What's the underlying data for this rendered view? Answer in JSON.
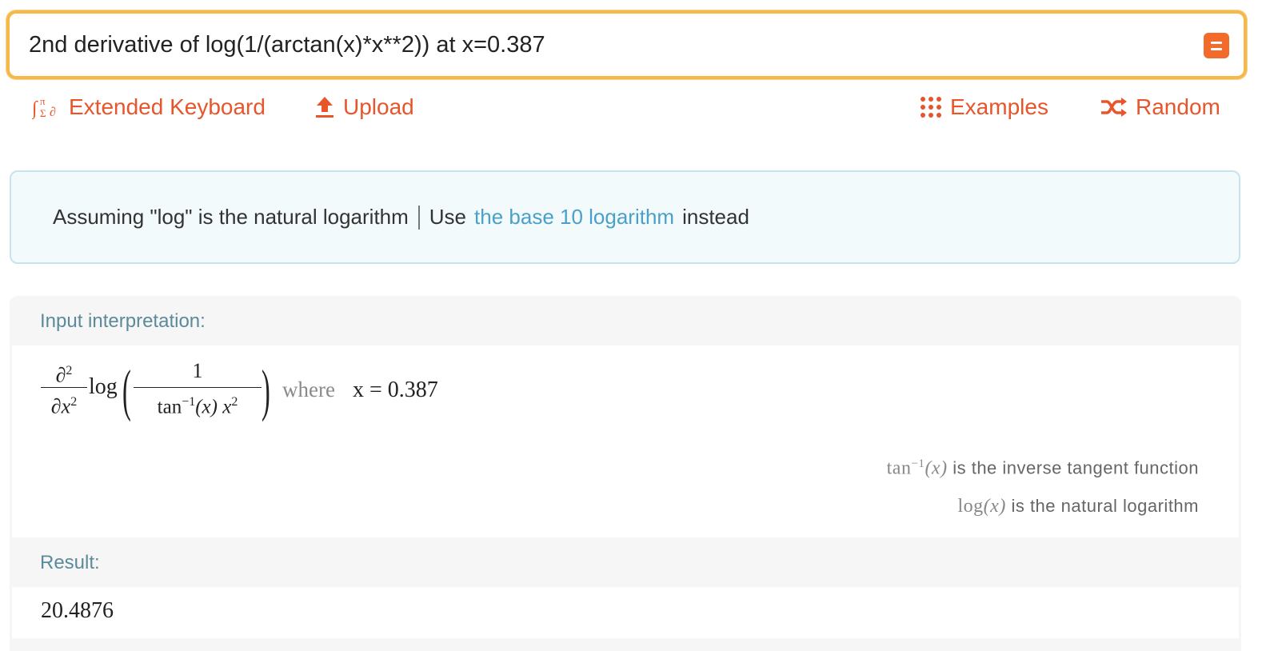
{
  "search": {
    "query": "2nd derivative of log(1/(arctan(x)*x**2)) at x=0.387"
  },
  "toolbar": {
    "keyboard_label": "Extended Keyboard",
    "upload_label": "Upload",
    "examples_label": "Examples",
    "random_label": "Random"
  },
  "assumption": {
    "prefix": "Assuming \"log\" is the natural logarithm",
    "use": "Use",
    "link": "the base 10 logarithm",
    "suffix": "instead"
  },
  "input_pod": {
    "title": "Input interpretation:",
    "partial_num": "∂",
    "partial_num_exp": "2",
    "partial_den": "∂x",
    "partial_den_exp": "2",
    "log": "log",
    "frac_num": "1",
    "frac_den_tan": "tan",
    "frac_den_exp": "−1",
    "frac_den_rest": "(x) x",
    "frac_den_x_exp": "2",
    "where": "where",
    "condition": "x = 0.387",
    "notes": [
      {
        "func": "tan",
        "exp": "−1",
        "arg": "(x)",
        "text": "is the inverse tangent function"
      },
      {
        "func": "log",
        "exp": "",
        "arg": "(x)",
        "text": "is the natural logarithm"
      }
    ]
  },
  "result_pod": {
    "title": "Result:",
    "value": "20.4876"
  },
  "colors": {
    "accent": "#e8552a",
    "search_border": "#f7b84a",
    "link": "#4aa0c8",
    "pod_title": "#5c8a9a"
  }
}
